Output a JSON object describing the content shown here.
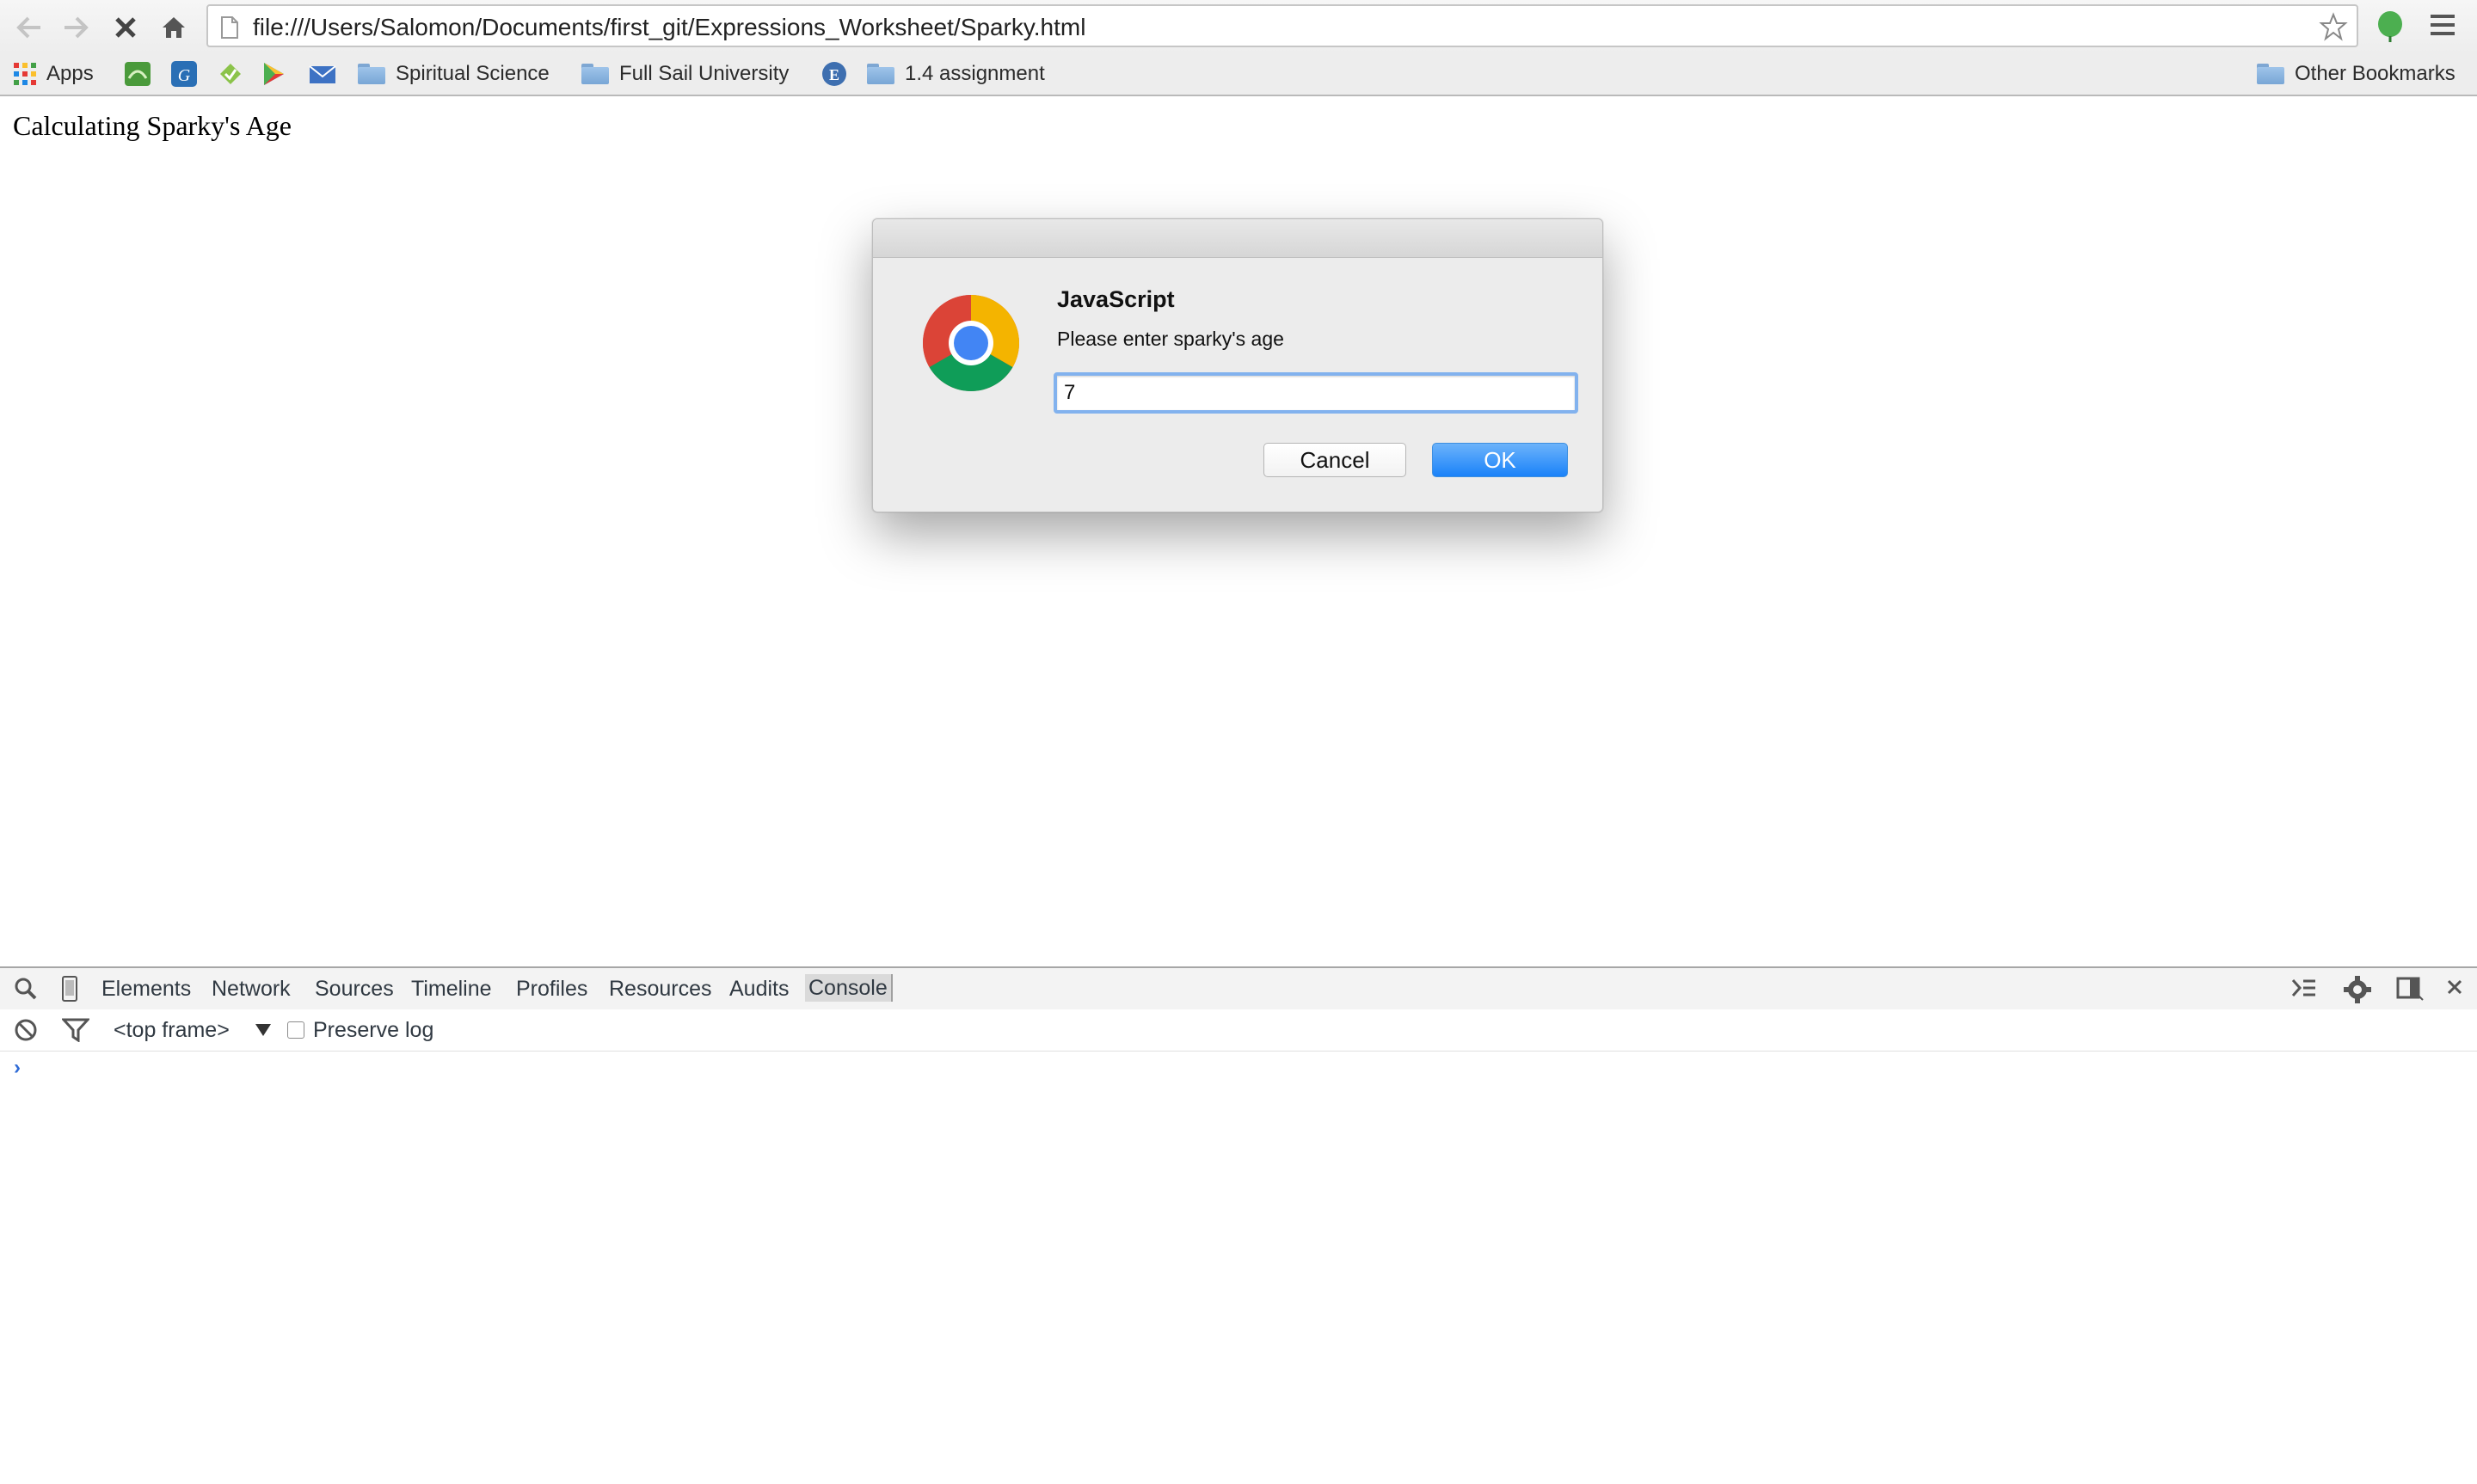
{
  "browser": {
    "url": "file:///Users/Salomon/Documents/first_git/Expressions_Worksheet/Sparky.html"
  },
  "bookmarks": {
    "apps_label": "Apps",
    "items": [
      {
        "label": "Spiritual Science"
      },
      {
        "label": "Full Sail University"
      },
      {
        "label": "1.4 assignment"
      }
    ],
    "other_label": "Other Bookmarks"
  },
  "page": {
    "heading": "Calculating Sparky's Age"
  },
  "dialog": {
    "title": "JavaScript",
    "message": "Please enter sparky's age",
    "input_value": "7",
    "cancel_label": "Cancel",
    "ok_label": "OK"
  },
  "devtools": {
    "tabs": [
      "Elements",
      "Network",
      "Sources",
      "Timeline",
      "Profiles",
      "Resources",
      "Audits",
      "Console"
    ],
    "active_tab": "Console",
    "frame_selector": "<top frame>",
    "preserve_log_label": "Preserve log",
    "prompt_symbol": "›"
  },
  "colors": {
    "ok_button": "#1a82f9",
    "focus_ring": "#82b2ee",
    "console_prompt": "#2f6bd6"
  }
}
